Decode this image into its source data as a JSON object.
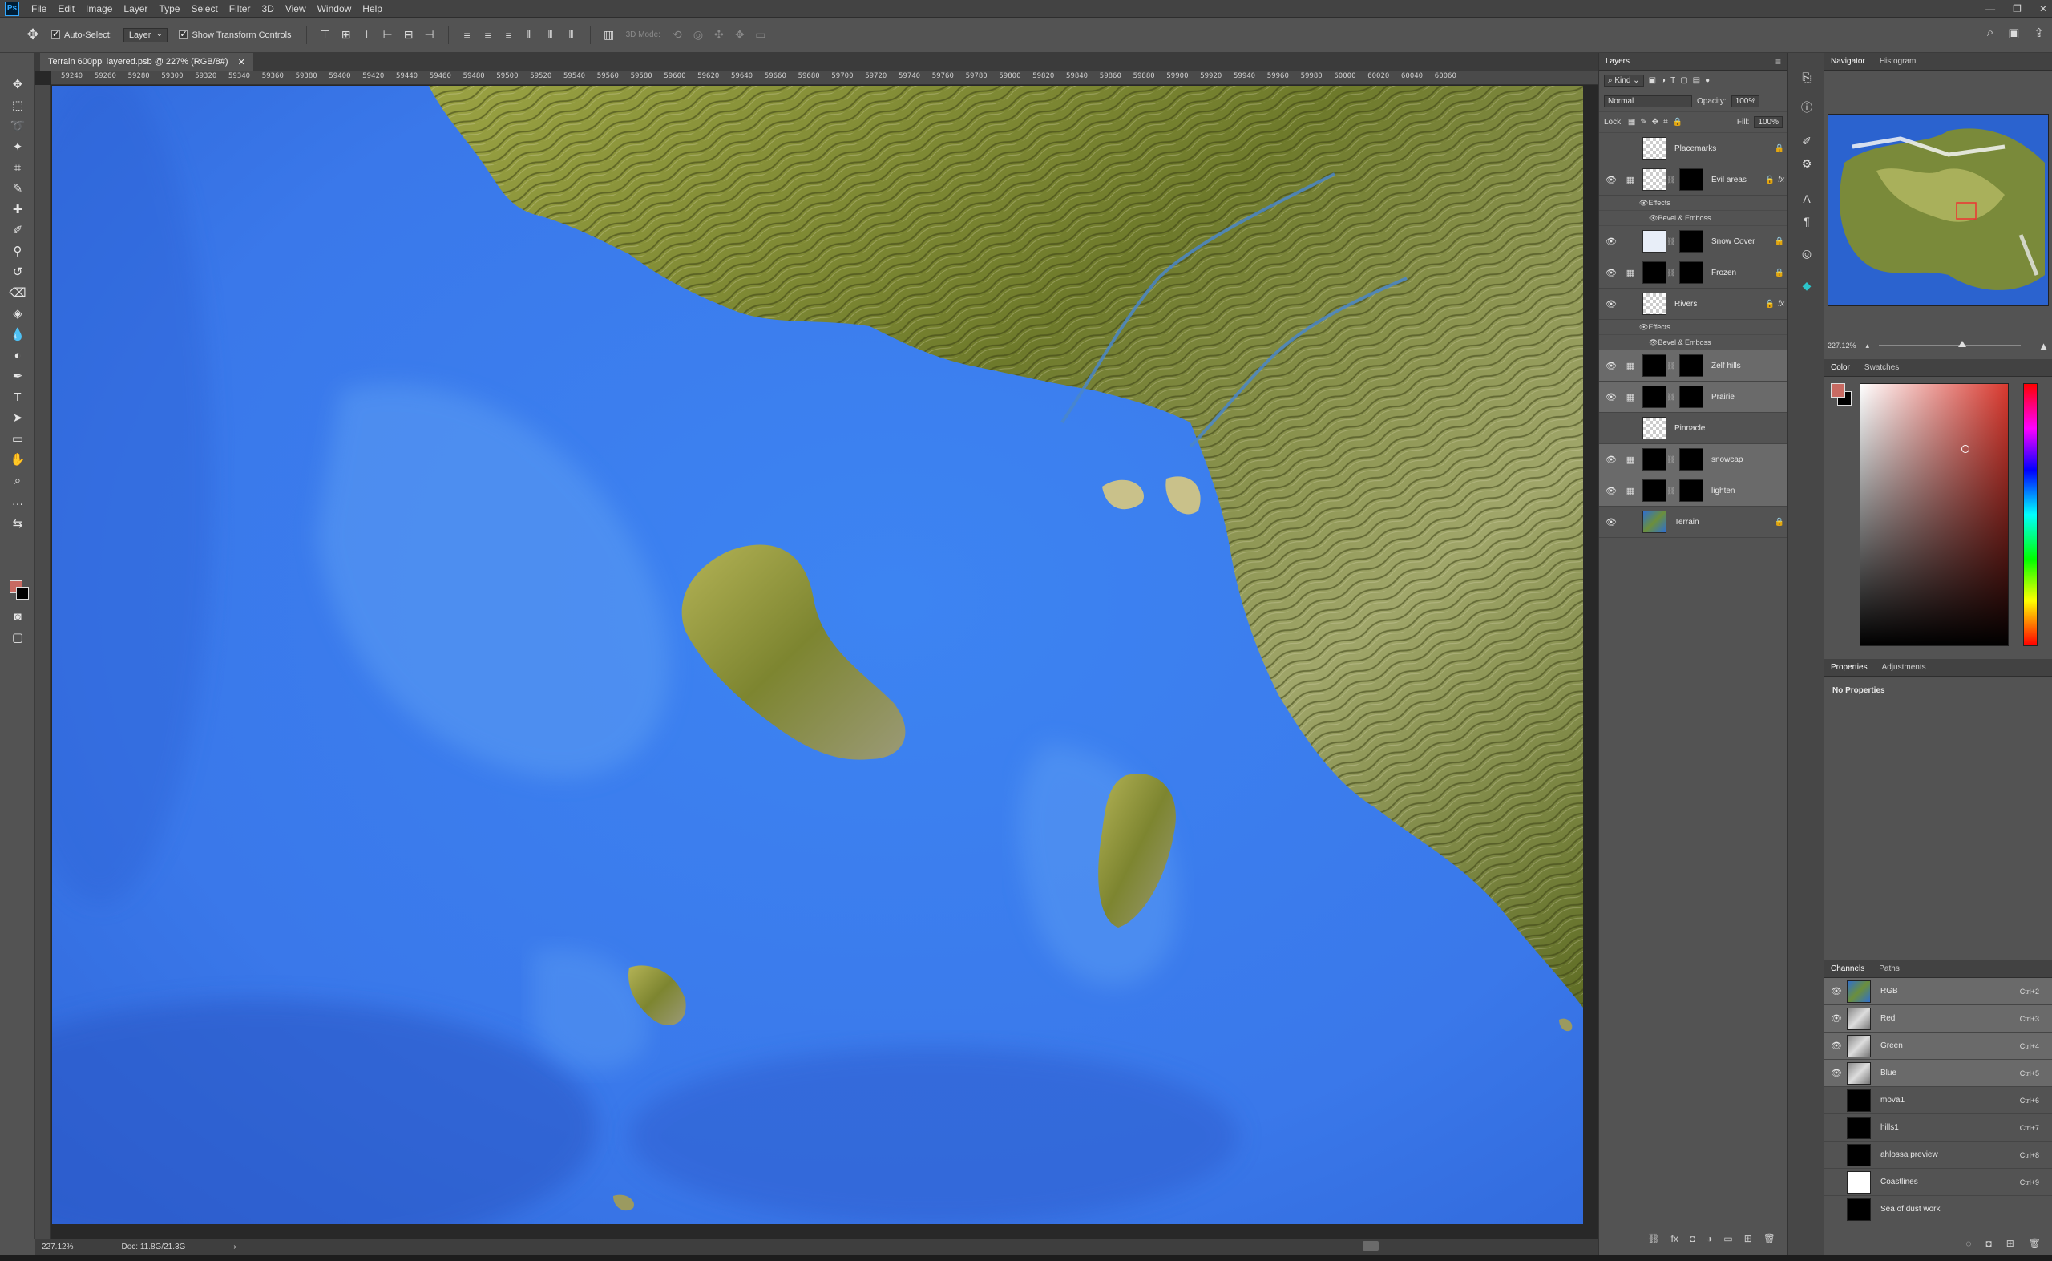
{
  "app": {
    "logo": "Ps",
    "menu": [
      "File",
      "Edit",
      "Image",
      "Layer",
      "Type",
      "Select",
      "Filter",
      "3D",
      "View",
      "Window",
      "Help"
    ],
    "window_controls": [
      "—",
      "❐",
      "✕"
    ]
  },
  "options": {
    "auto_select_label": "Auto-Select:",
    "auto_select_target": "Layer",
    "show_transform_label": "Show Transform Controls",
    "mode_3d_label": "3D Mode:"
  },
  "document": {
    "tab_title": "Terrain 600ppi layered.psb @ 227% (RGB/8#)",
    "close_glyph": "✕"
  },
  "ruler_ticks": [
    "59240",
    "59260",
    "59280",
    "59300",
    "59320",
    "59340",
    "59360",
    "59380",
    "59400",
    "59420",
    "59440",
    "59460",
    "59480",
    "59500",
    "59520",
    "59540",
    "59560",
    "59580",
    "59600",
    "59620",
    "59640",
    "59660",
    "59680",
    "59700",
    "59720",
    "59740",
    "59760",
    "59780",
    "59800",
    "59820",
    "59840",
    "59860",
    "59880",
    "59900",
    "59920",
    "59940",
    "59960",
    "59980",
    "60000",
    "60020",
    "60040",
    "60060"
  ],
  "status": {
    "zoom": "227.12%",
    "doc": "Doc: 11.8G/21.3G",
    "arrow": "›"
  },
  "layers_panel": {
    "tab": "Layers",
    "kind_label": "Kind",
    "blend_mode": "Normal",
    "opacity_label": "Opacity:",
    "opacity_value": "100%",
    "lock_label": "Lock:",
    "fill_label": "Fill:",
    "fill_value": "100%",
    "effects_label": "Effects",
    "bevel_label": "Bevel & Emboss",
    "layers": [
      {
        "name": "Placemarks",
        "visible": false,
        "thumb": "checker",
        "mask": false,
        "lock": true,
        "fx": false,
        "effects": false,
        "selected": false,
        "adj": false
      },
      {
        "name": "Evil areas",
        "visible": true,
        "thumb": "checker",
        "mask": true,
        "lock": true,
        "fx": true,
        "effects": true,
        "selected": false,
        "adj": true
      },
      {
        "name": "Snow Cover",
        "visible": true,
        "thumb": "light",
        "mask": true,
        "lock": true,
        "fx": false,
        "effects": false,
        "selected": false,
        "adj": false
      },
      {
        "name": "Frozen",
        "visible": true,
        "thumb": "black",
        "mask": true,
        "lock": true,
        "fx": false,
        "effects": false,
        "selected": false,
        "adj": true
      },
      {
        "name": "Rivers",
        "visible": true,
        "thumb": "checker",
        "mask": false,
        "lock": true,
        "fx": true,
        "effects": true,
        "selected": false,
        "adj": false
      },
      {
        "name": "Zelf hills",
        "visible": true,
        "thumb": "black",
        "mask": true,
        "lock": false,
        "fx": false,
        "effects": false,
        "selected": true,
        "adj": true
      },
      {
        "name": "Prairie",
        "visible": true,
        "thumb": "black",
        "mask": true,
        "lock": false,
        "fx": false,
        "effects": false,
        "selected": true,
        "adj": true
      },
      {
        "name": "Pinnacle",
        "visible": false,
        "thumb": "checker",
        "mask": false,
        "lock": false,
        "fx": false,
        "effects": false,
        "selected": false,
        "adj": false
      },
      {
        "name": "snowcap",
        "visible": true,
        "thumb": "black",
        "mask": true,
        "lock": false,
        "fx": false,
        "effects": false,
        "selected": true,
        "adj": true
      },
      {
        "name": "lighten",
        "visible": true,
        "thumb": "black",
        "mask": true,
        "lock": false,
        "fx": false,
        "effects": false,
        "selected": true,
        "adj": true
      },
      {
        "name": "Terrain",
        "visible": true,
        "thumb": "terrain",
        "mask": false,
        "lock": true,
        "fx": false,
        "effects": false,
        "selected": false,
        "adj": false
      }
    ]
  },
  "navigator": {
    "tabs": [
      "Navigator",
      "Histogram"
    ],
    "zoom": "227.12%"
  },
  "color_panel": {
    "tabs": [
      "Color",
      "Swatches"
    ],
    "fg_color": "#c86a62",
    "bg_color": "#000000"
  },
  "properties_panel": {
    "tabs": [
      "Properties",
      "Adjustments"
    ],
    "empty_text": "No Properties"
  },
  "channels_panel": {
    "tabs": [
      "Channels",
      "Paths"
    ],
    "channels": [
      {
        "name": "RGB",
        "shortcut": "Ctrl+2",
        "visible": true,
        "thumb": "color",
        "selected": true
      },
      {
        "name": "Red",
        "shortcut": "Ctrl+3",
        "visible": true,
        "thumb": "gray",
        "selected": true
      },
      {
        "name": "Green",
        "shortcut": "Ctrl+4",
        "visible": true,
        "thumb": "gray",
        "selected": true
      },
      {
        "name": "Blue",
        "shortcut": "Ctrl+5",
        "visible": true,
        "thumb": "gray",
        "selected": true
      },
      {
        "name": "mova1",
        "shortcut": "Ctrl+6",
        "visible": false,
        "thumb": "black",
        "selected": false
      },
      {
        "name": "hills1",
        "shortcut": "Ctrl+7",
        "visible": false,
        "thumb": "black",
        "selected": false
      },
      {
        "name": "ahlossa preview",
        "shortcut": "Ctrl+8",
        "visible": false,
        "thumb": "black",
        "selected": false
      },
      {
        "name": "Coastlines",
        "shortcut": "Ctrl+9",
        "visible": false,
        "thumb": "white",
        "selected": false
      },
      {
        "name": "Sea of dust work",
        "shortcut": "",
        "visible": false,
        "thumb": "black",
        "selected": false
      }
    ]
  },
  "colors": {
    "ocean_deep": "#2a5fd0",
    "ocean_mid": "#3f82f0",
    "shallow": "#5e9cf2",
    "land_light": "#a6a94a",
    "land_dark": "#5a6424",
    "river": "#4a86c8"
  }
}
